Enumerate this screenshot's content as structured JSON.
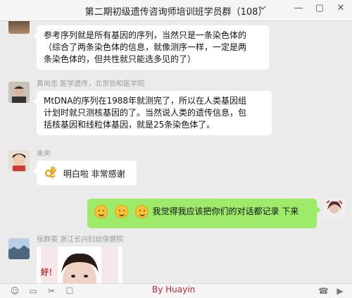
{
  "window": {
    "title": "第二期初级遗传咨询师培训班学员群（108）"
  },
  "messages": [
    {
      "sender": "",
      "lines": [
        "参考序列就是所有基因的序列，当然只是一条染色体的",
        "（综合了两条染色体的信息，就像测序一样，一定是两",
        "条染色体的，但共性就只能选多见的了）"
      ]
    },
    {
      "sender": "黄尚志 医学遗传，北京协和医学院",
      "lines": [
        "MtDNA的序列在1988年就测完了，所以在人类基因组",
        "计划时就只测核基因的了。当然说人类的遗传信息，包",
        "括核基因和线粒体基因，就是25条染色体了。"
      ]
    },
    {
      "sender": "未央",
      "text": "明白啦 非常感谢"
    },
    {
      "sender": "",
      "text": "我觉得我应该把你们的对话都记录 下来"
    },
    {
      "sender": "张群英 浙江长兴妇幼保健院",
      "image_text": "好！"
    }
  ],
  "footer": {
    "credit": "By Huayin"
  }
}
